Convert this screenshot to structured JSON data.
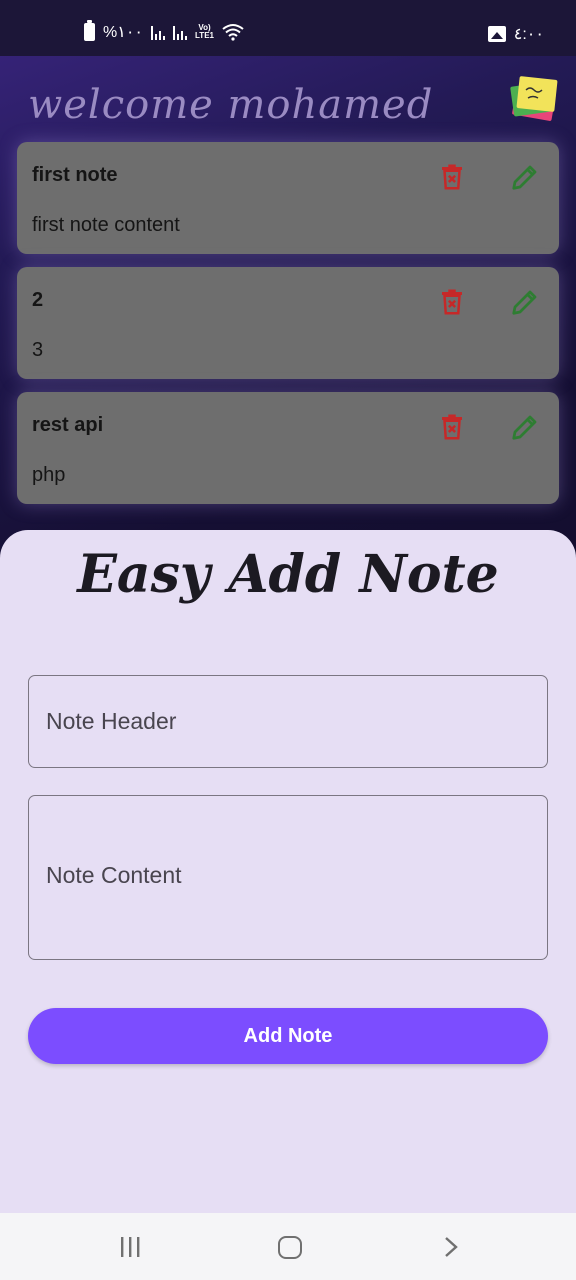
{
  "status_bar": {
    "battery_text": "%١٠٠",
    "network_label_top": "Vo)",
    "network_label_bottom": "LTE1",
    "time": "٤:٠٠",
    "icons": [
      "battery-icon",
      "signal-icon",
      "signal-icon",
      "volte-icon",
      "wifi-icon",
      "gallery-icon"
    ]
  },
  "header": {
    "welcome": "welcome mohamed",
    "logo_icon": "sticky-notes-icon"
  },
  "notes": [
    {
      "title": "first note",
      "content": "first note content"
    },
    {
      "title": "2",
      "content": "3"
    },
    {
      "title": "rest api",
      "content": "php"
    }
  ],
  "note_actions": {
    "delete_icon": "delete-icon",
    "edit_icon": "edit-icon"
  },
  "sheet": {
    "title": "Easy Add Note",
    "header_placeholder": "Note Header",
    "content_placeholder": "Note Content",
    "add_button": "Add Note"
  },
  "nav": {
    "icons": [
      "recent-apps-icon",
      "home-icon",
      "back-icon"
    ]
  },
  "colors": {
    "accent": "#7c4dff",
    "sheet_bg": "#e6def4",
    "card_bg": "#6e6e6e",
    "delete": "#c62828",
    "edit": "#2e7d32"
  }
}
